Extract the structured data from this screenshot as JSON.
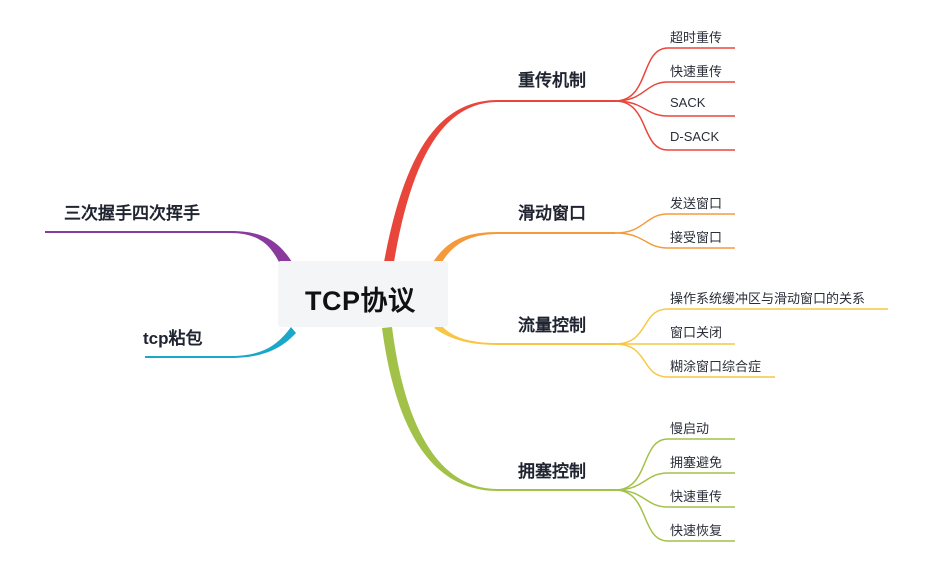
{
  "center": {
    "label": "TCP协议"
  },
  "right_branches": [
    {
      "label": "重传机制",
      "color": "#e8463b",
      "leaves": [
        "超时重传",
        "快速重传",
        "SACK",
        "D-SACK"
      ]
    },
    {
      "label": "滑动窗口",
      "color": "#f59a3b",
      "leaves": [
        "发送窗口",
        "接受窗口"
      ]
    },
    {
      "label": "流量控制",
      "color": "#f7c744",
      "leaves": [
        "操作系统缓冲区与滑动窗口的关系",
        "窗口关闭",
        "糊涂窗口综合症"
      ]
    },
    {
      "label": "拥塞控制",
      "color": "#a2c148",
      "leaves": [
        "慢启动",
        "拥塞避免",
        "快速重传",
        "快速恢复"
      ]
    }
  ],
  "left_branches": [
    {
      "label": "三次握手四次挥手",
      "color": "#8a3a9c"
    },
    {
      "label": "tcp粘包",
      "color": "#1aa7c9"
    }
  ]
}
